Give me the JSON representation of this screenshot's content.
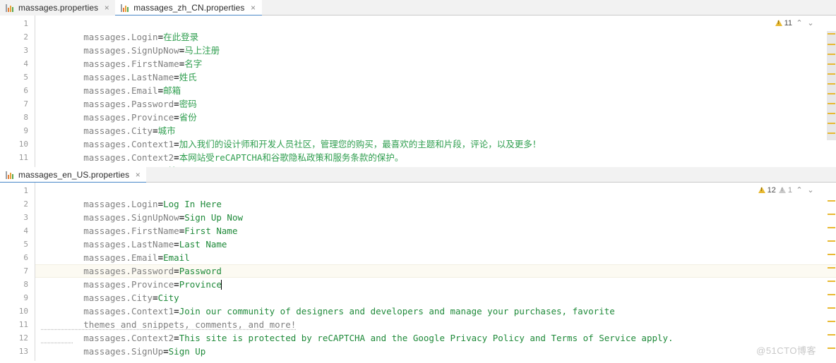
{
  "tabbars": {
    "top": {
      "tabs": [
        {
          "label": "massages.properties",
          "icon": "properties-file-icon",
          "close": "×",
          "active": false
        },
        {
          "label": "massages_zh_CN.properties",
          "icon": "properties-file-icon",
          "close": "×",
          "active": true
        }
      ]
    },
    "bottom": {
      "tabs": [
        {
          "label": "massages_en_US.properties",
          "icon": "properties-file-icon",
          "close": "×",
          "active": true
        }
      ]
    }
  },
  "editor_top": {
    "file": "massages_zh_CN.properties",
    "line_numbers": [
      "1",
      "2",
      "3",
      "4",
      "5",
      "6",
      "7",
      "8",
      "9",
      "10",
      "11"
    ],
    "lines": [
      {
        "key": "massages.Login",
        "eq": "=",
        "value": "在此登录"
      },
      {
        "key": "massages.SignUpNow",
        "eq": "=",
        "value": "马上注册"
      },
      {
        "key": "massages.FirstName",
        "eq": "=",
        "value": "名字"
      },
      {
        "key": "massages.LastName",
        "eq": "=",
        "value": "姓氏"
      },
      {
        "key": "massages.Email",
        "eq": "=",
        "value": "邮箱"
      },
      {
        "key": "massages.Password",
        "eq": "=",
        "value": "密码"
      },
      {
        "key": "massages.Province",
        "eq": "=",
        "value": "省份"
      },
      {
        "key": "massages.City",
        "eq": "=",
        "value": "城市"
      },
      {
        "key": "massages.Context1",
        "eq": "=",
        "value": "加入我们的设计师和开发人员社区，管理您的购买，最喜欢的主题和片段，评论，以及更多！"
      },
      {
        "key": "massages.Context2",
        "eq": "=",
        "value": "本网站受reCAPTCHA和谷歌隐私政策和服务条款的保护。"
      },
      {
        "key": "massages.SignUp",
        "eq": "=",
        "value": "注册"
      }
    ],
    "inspection": {
      "warning_icon": "warning-triangle-icon",
      "warning_count": "11",
      "prev_icon": "chevron-up-icon",
      "next_icon": "chevron-down-icon",
      "prev_glyph": "⌃",
      "next_glyph": "⌄"
    },
    "stripe_marks": 11
  },
  "editor_bottom": {
    "file": "massages_en_US.properties",
    "line_numbers": [
      "1",
      "2",
      "3",
      "4",
      "5",
      "6",
      "7",
      "8",
      "9",
      "10",
      "11",
      "12",
      "13"
    ],
    "current_line": 7,
    "lines": [
      {
        "key": "massages.Login",
        "eq": "=",
        "value": "Log In Here"
      },
      {
        "key": "massages.SignUpNow",
        "eq": "=",
        "value": "Sign Up Now"
      },
      {
        "key": "massages.FirstName",
        "eq": "=",
        "value": "First Name"
      },
      {
        "key": "massages.LastName",
        "eq": "=",
        "value": "Last Name"
      },
      {
        "key": "massages.Email",
        "eq": "=",
        "value": "Email"
      },
      {
        "key": "massages.Password",
        "eq": "=",
        "value": "Password"
      },
      {
        "key": "massages.Province",
        "eq": "=",
        "value": "Province"
      },
      {
        "key": "massages.City",
        "eq": "=",
        "value": "City"
      },
      {
        "key": "massages.Context1",
        "eq": "=",
        "value": "Join our community of designers and developers and manage your purchases, favorite"
      },
      {
        "key": "",
        "eq": "",
        "value": "themes and snippets, comments, and more!",
        "continuation": true
      },
      {
        "key": "massages.Context2",
        "eq": "=",
        "value": "This site is protected by reCAPTCHA and the Google Privacy Policy and Terms of Service apply."
      },
      {
        "key": "massages.SignUp",
        "eq": "=",
        "value": "Sign Up"
      },
      {
        "key": "",
        "eq": "",
        "value": ""
      }
    ],
    "inspection": {
      "warning_icon": "warning-triangle-icon",
      "warning_count": "12",
      "weak_warning_icon": "weak-warning-triangle-icon",
      "weak_warning_count": "1",
      "prev_icon": "chevron-up-icon",
      "next_icon": "chevron-down-icon",
      "prev_glyph": "⌃",
      "next_glyph": "⌄"
    },
    "stripe_marks": 12
  },
  "watermark": "@51CTO博客",
  "colors": {
    "key": "#808080",
    "value": "#1f8a3a",
    "warning": "#e8b931",
    "active_tab_underline": "#4a88c7",
    "current_line_bg": "#fcfaf2"
  }
}
